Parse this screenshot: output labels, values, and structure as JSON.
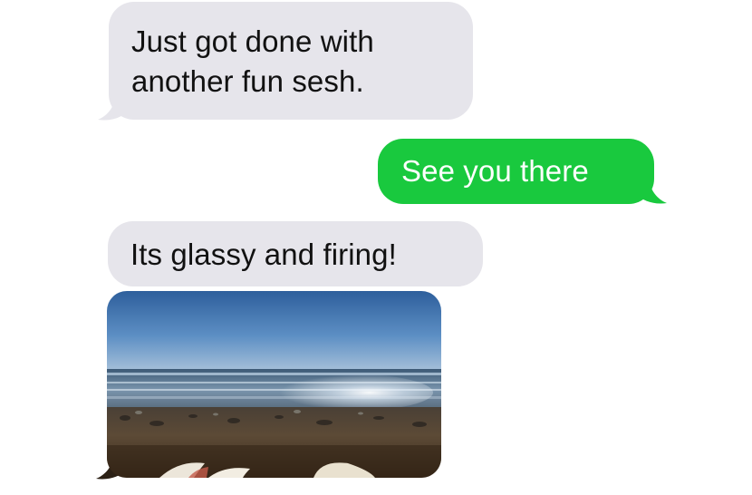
{
  "conversation": {
    "messages": [
      {
        "direction": "incoming",
        "text": "Just got done with another fun sesh."
      },
      {
        "direction": "outgoing",
        "text": "See you there"
      },
      {
        "direction": "incoming",
        "text": "Its glassy and firing!"
      }
    ],
    "photo": {
      "kind": "incoming-photo",
      "icon": "beach-surf-photo"
    }
  },
  "colors": {
    "incoming_bubble": "#e6e5eb",
    "outgoing_bubble": "#19c93e",
    "incoming_text": "#111111",
    "outgoing_text": "#ffffff",
    "background": "#ffffff"
  }
}
